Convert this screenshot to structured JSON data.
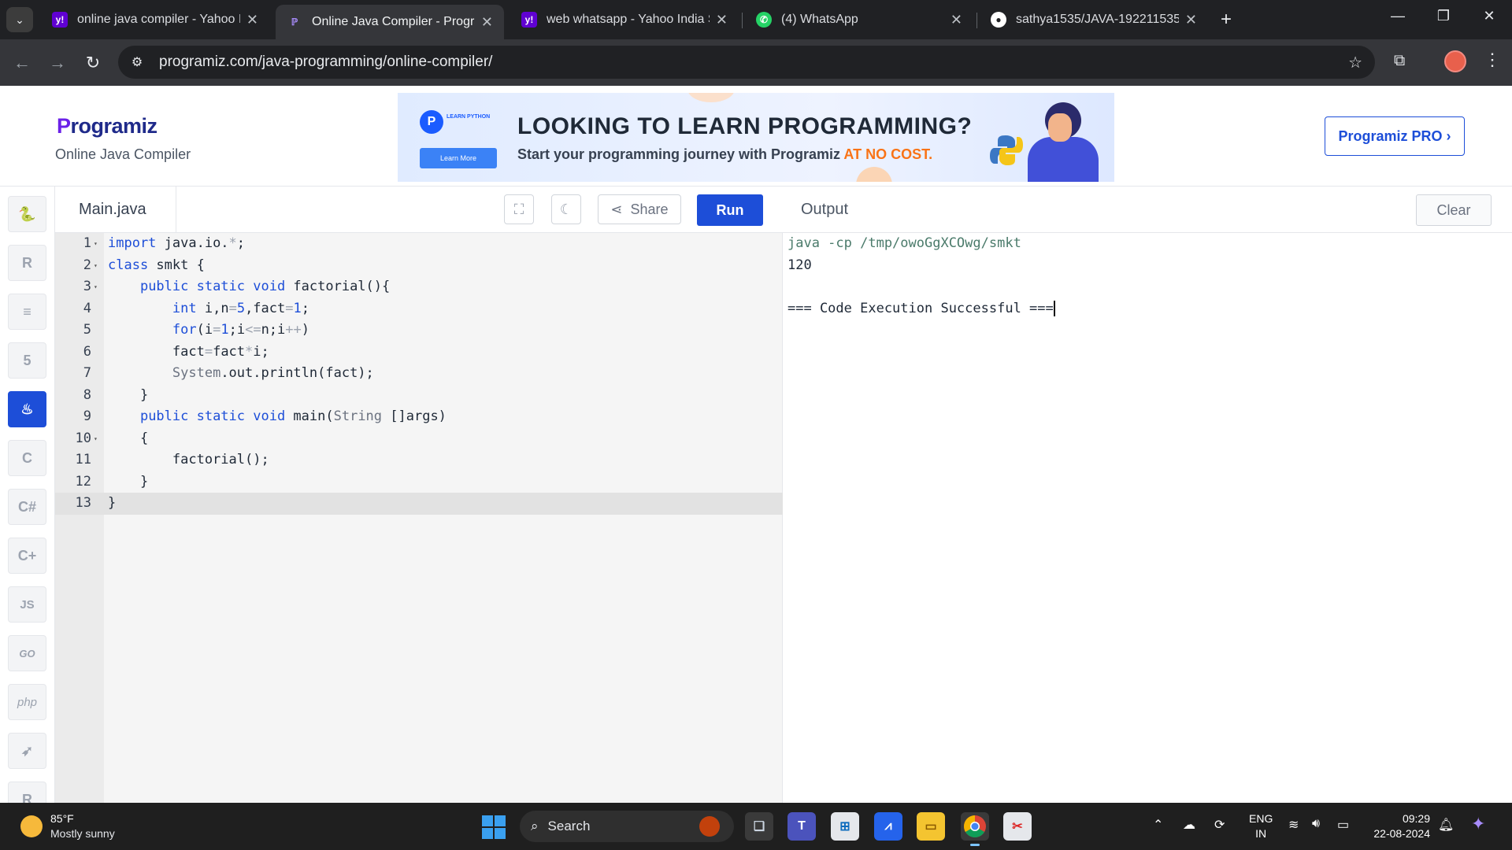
{
  "browser": {
    "tabs": [
      {
        "title": "online java compiler - Yahoo India Search Results",
        "favicon": "yahoo-icon",
        "favicon_color": "#6001d2"
      },
      {
        "title": "Online Java Compiler - Programiz",
        "favicon": "programiz-icon",
        "favicon_color": "#6b21e8"
      },
      {
        "title": "web whatsapp - Yahoo India Search Results",
        "favicon": "yahoo-icon",
        "favicon_color": "#6001d2"
      },
      {
        "title": "(4) WhatsApp",
        "favicon": "whatsapp-icon",
        "favicon_color": "#25d366"
      },
      {
        "title": "sathya1535/JAVA-192211535",
        "favicon": "github-icon",
        "favicon_color": "#ffffff"
      }
    ],
    "url": "programiz.com/java-programming/online-compiler/"
  },
  "header": {
    "logo_text": "rogramiz",
    "logo_letter": "P",
    "subtitle": "Online Java Compiler",
    "pro_button": "Programiz PRO ›"
  },
  "banner": {
    "badge_text": "LEARN PYTHON",
    "badge_button": "Learn More",
    "headline": "LOOKING TO LEARN PROGRAMMING?",
    "subline": "Start your programming journey with Programiz",
    "highlight": "AT NO COST."
  },
  "rail": {
    "items": [
      {
        "name": "python",
        "glyph": "🐍"
      },
      {
        "name": "r",
        "glyph": "R"
      },
      {
        "name": "sql",
        "glyph": "≡"
      },
      {
        "name": "html",
        "glyph": "5"
      },
      {
        "name": "java",
        "glyph": "♨",
        "active": true
      },
      {
        "name": "c",
        "glyph": "C"
      },
      {
        "name": "csharp",
        "glyph": "C#"
      },
      {
        "name": "cpp",
        "glyph": "C+"
      },
      {
        "name": "js",
        "glyph": "JS"
      },
      {
        "name": "go",
        "glyph": "GO"
      },
      {
        "name": "php",
        "glyph": "php"
      },
      {
        "name": "swift",
        "glyph": "➶"
      },
      {
        "name": "rust",
        "glyph": "R"
      }
    ]
  },
  "editor": {
    "filename": "Main.java",
    "share_label": "Share",
    "run_label": "Run",
    "current_line": 13,
    "lines": [
      {
        "n": "1",
        "fold": true,
        "html": "<span class=\"kw\">import</span> java.io.<span class=\"op\">*</span>;"
      },
      {
        "n": "2",
        "fold": true,
        "html": "<span class=\"kw\">class</span> smkt {"
      },
      {
        "n": "3",
        "fold": true,
        "html": "    <span class=\"kw\">public static void</span> factorial(){"
      },
      {
        "n": "4",
        "fold": false,
        "html": "        <span class=\"kw\">int</span> i,n<span class=\"op\">=</span><span class=\"nm\">5</span>,fact<span class=\"op\">=</span><span class=\"nm\">1</span>;"
      },
      {
        "n": "5",
        "fold": false,
        "html": "        <span class=\"kw\">for</span>(i<span class=\"op\">=</span><span class=\"nm\">1</span>;i<span class=\"op\">&lt;=</span>n;i<span class=\"op\">++</span>)"
      },
      {
        "n": "6",
        "fold": false,
        "html": "        fact<span class=\"op\">=</span>fact<span class=\"op\">*</span>i;"
      },
      {
        "n": "7",
        "fold": false,
        "html": "        <span class=\"ty\">System</span>.out.println(fact);"
      },
      {
        "n": "8",
        "fold": false,
        "html": "    }"
      },
      {
        "n": "9",
        "fold": false,
        "html": "    <span class=\"kw\">public static void</span> main(<span class=\"ty\">String</span> []args)"
      },
      {
        "n": "10",
        "fold": true,
        "html": "    {"
      },
      {
        "n": "11",
        "fold": false,
        "html": "        factorial();"
      },
      {
        "n": "12",
        "fold": false,
        "html": "    }"
      },
      {
        "n": "13",
        "fold": false,
        "html": "}"
      }
    ]
  },
  "output": {
    "title": "Output",
    "clear_label": "Clear",
    "lines": [
      {
        "text": "java -cp /tmp/owoGgXCOwg/smkt",
        "type": "cmd"
      },
      {
        "text": "120",
        "type": "out"
      },
      {
        "text": "",
        "type": "out"
      },
      {
        "text": "=== Code Execution Successful ===",
        "type": "out",
        "caret": true
      }
    ]
  },
  "taskbar": {
    "weather_temp": "85°F",
    "weather_desc": "Mostly sunny",
    "search_placeholder": "Search",
    "lang_top": "ENG",
    "lang_bottom": "IN",
    "time": "09:29",
    "date": "22-08-2024"
  }
}
